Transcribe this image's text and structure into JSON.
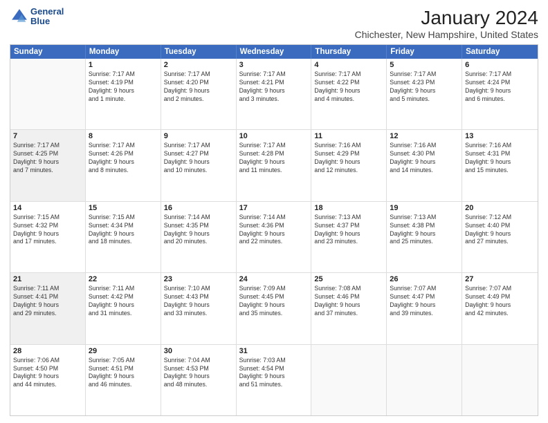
{
  "logo": {
    "line1": "General",
    "line2": "Blue"
  },
  "title": "January 2024",
  "location": "Chichester, New Hampshire, United States",
  "weekdays": [
    "Sunday",
    "Monday",
    "Tuesday",
    "Wednesday",
    "Thursday",
    "Friday",
    "Saturday"
  ],
  "rows": [
    [
      {
        "day": "",
        "lines": [],
        "empty": true
      },
      {
        "day": "1",
        "lines": [
          "Sunrise: 7:17 AM",
          "Sunset: 4:19 PM",
          "Daylight: 9 hours",
          "and 1 minute."
        ]
      },
      {
        "day": "2",
        "lines": [
          "Sunrise: 7:17 AM",
          "Sunset: 4:20 PM",
          "Daylight: 9 hours",
          "and 2 minutes."
        ]
      },
      {
        "day": "3",
        "lines": [
          "Sunrise: 7:17 AM",
          "Sunset: 4:21 PM",
          "Daylight: 9 hours",
          "and 3 minutes."
        ]
      },
      {
        "day": "4",
        "lines": [
          "Sunrise: 7:17 AM",
          "Sunset: 4:22 PM",
          "Daylight: 9 hours",
          "and 4 minutes."
        ]
      },
      {
        "day": "5",
        "lines": [
          "Sunrise: 7:17 AM",
          "Sunset: 4:23 PM",
          "Daylight: 9 hours",
          "and 5 minutes."
        ]
      },
      {
        "day": "6",
        "lines": [
          "Sunrise: 7:17 AM",
          "Sunset: 4:24 PM",
          "Daylight: 9 hours",
          "and 6 minutes."
        ]
      }
    ],
    [
      {
        "day": "7",
        "lines": [
          "Sunrise: 7:17 AM",
          "Sunset: 4:25 PM",
          "Daylight: 9 hours",
          "and 7 minutes."
        ],
        "shaded": true
      },
      {
        "day": "8",
        "lines": [
          "Sunrise: 7:17 AM",
          "Sunset: 4:26 PM",
          "Daylight: 9 hours",
          "and 8 minutes."
        ]
      },
      {
        "day": "9",
        "lines": [
          "Sunrise: 7:17 AM",
          "Sunset: 4:27 PM",
          "Daylight: 9 hours",
          "and 10 minutes."
        ]
      },
      {
        "day": "10",
        "lines": [
          "Sunrise: 7:17 AM",
          "Sunset: 4:28 PM",
          "Daylight: 9 hours",
          "and 11 minutes."
        ]
      },
      {
        "day": "11",
        "lines": [
          "Sunrise: 7:16 AM",
          "Sunset: 4:29 PM",
          "Daylight: 9 hours",
          "and 12 minutes."
        ]
      },
      {
        "day": "12",
        "lines": [
          "Sunrise: 7:16 AM",
          "Sunset: 4:30 PM",
          "Daylight: 9 hours",
          "and 14 minutes."
        ]
      },
      {
        "day": "13",
        "lines": [
          "Sunrise: 7:16 AM",
          "Sunset: 4:31 PM",
          "Daylight: 9 hours",
          "and 15 minutes."
        ]
      }
    ],
    [
      {
        "day": "14",
        "lines": [
          "Sunrise: 7:15 AM",
          "Sunset: 4:32 PM",
          "Daylight: 9 hours",
          "and 17 minutes."
        ]
      },
      {
        "day": "15",
        "lines": [
          "Sunrise: 7:15 AM",
          "Sunset: 4:34 PM",
          "Daylight: 9 hours",
          "and 18 minutes."
        ]
      },
      {
        "day": "16",
        "lines": [
          "Sunrise: 7:14 AM",
          "Sunset: 4:35 PM",
          "Daylight: 9 hours",
          "and 20 minutes."
        ]
      },
      {
        "day": "17",
        "lines": [
          "Sunrise: 7:14 AM",
          "Sunset: 4:36 PM",
          "Daylight: 9 hours",
          "and 22 minutes."
        ]
      },
      {
        "day": "18",
        "lines": [
          "Sunrise: 7:13 AM",
          "Sunset: 4:37 PM",
          "Daylight: 9 hours",
          "and 23 minutes."
        ]
      },
      {
        "day": "19",
        "lines": [
          "Sunrise: 7:13 AM",
          "Sunset: 4:38 PM",
          "Daylight: 9 hours",
          "and 25 minutes."
        ]
      },
      {
        "day": "20",
        "lines": [
          "Sunrise: 7:12 AM",
          "Sunset: 4:40 PM",
          "Daylight: 9 hours",
          "and 27 minutes."
        ]
      }
    ],
    [
      {
        "day": "21",
        "lines": [
          "Sunrise: 7:11 AM",
          "Sunset: 4:41 PM",
          "Daylight: 9 hours",
          "and 29 minutes."
        ],
        "shaded": true
      },
      {
        "day": "22",
        "lines": [
          "Sunrise: 7:11 AM",
          "Sunset: 4:42 PM",
          "Daylight: 9 hours",
          "and 31 minutes."
        ]
      },
      {
        "day": "23",
        "lines": [
          "Sunrise: 7:10 AM",
          "Sunset: 4:43 PM",
          "Daylight: 9 hours",
          "and 33 minutes."
        ]
      },
      {
        "day": "24",
        "lines": [
          "Sunrise: 7:09 AM",
          "Sunset: 4:45 PM",
          "Daylight: 9 hours",
          "and 35 minutes."
        ]
      },
      {
        "day": "25",
        "lines": [
          "Sunrise: 7:08 AM",
          "Sunset: 4:46 PM",
          "Daylight: 9 hours",
          "and 37 minutes."
        ]
      },
      {
        "day": "26",
        "lines": [
          "Sunrise: 7:07 AM",
          "Sunset: 4:47 PM",
          "Daylight: 9 hours",
          "and 39 minutes."
        ]
      },
      {
        "day": "27",
        "lines": [
          "Sunrise: 7:07 AM",
          "Sunset: 4:49 PM",
          "Daylight: 9 hours",
          "and 42 minutes."
        ]
      }
    ],
    [
      {
        "day": "28",
        "lines": [
          "Sunrise: 7:06 AM",
          "Sunset: 4:50 PM",
          "Daylight: 9 hours",
          "and 44 minutes."
        ]
      },
      {
        "day": "29",
        "lines": [
          "Sunrise: 7:05 AM",
          "Sunset: 4:51 PM",
          "Daylight: 9 hours",
          "and 46 minutes."
        ]
      },
      {
        "day": "30",
        "lines": [
          "Sunrise: 7:04 AM",
          "Sunset: 4:53 PM",
          "Daylight: 9 hours",
          "and 48 minutes."
        ]
      },
      {
        "day": "31",
        "lines": [
          "Sunrise: 7:03 AM",
          "Sunset: 4:54 PM",
          "Daylight: 9 hours",
          "and 51 minutes."
        ]
      },
      {
        "day": "",
        "lines": [],
        "empty": true
      },
      {
        "day": "",
        "lines": [],
        "empty": true
      },
      {
        "day": "",
        "lines": [],
        "empty": true
      }
    ]
  ]
}
